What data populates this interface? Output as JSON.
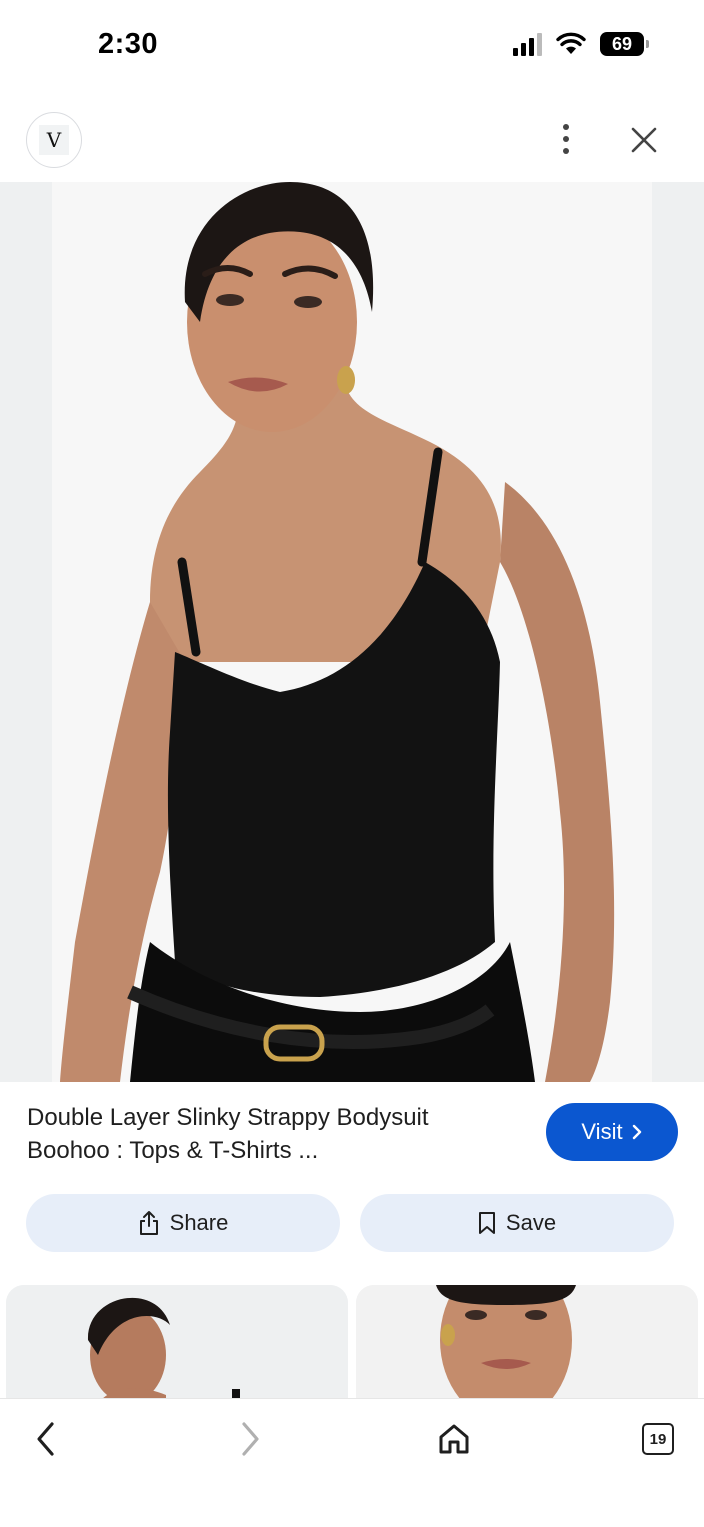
{
  "status_bar": {
    "time": "2:30",
    "battery": "69"
  },
  "header": {
    "site_icon_letter": "V",
    "more_icon": "more-vert-icon",
    "close_icon": "close-icon"
  },
  "result": {
    "title_line1": "Double Layer Slinky Strappy Bodysuit",
    "title_line2": "Boohoo : Tops & T-Shirts ...",
    "visit_label": "Visit"
  },
  "actions": {
    "share_label": "Share",
    "save_label": "Save"
  },
  "bottom_bar": {
    "tab_count": "19"
  },
  "colors": {
    "visit_button_bg": "#0b57d0",
    "action_button_bg": "#e7eef9",
    "image_bg": "#eef0f1"
  }
}
